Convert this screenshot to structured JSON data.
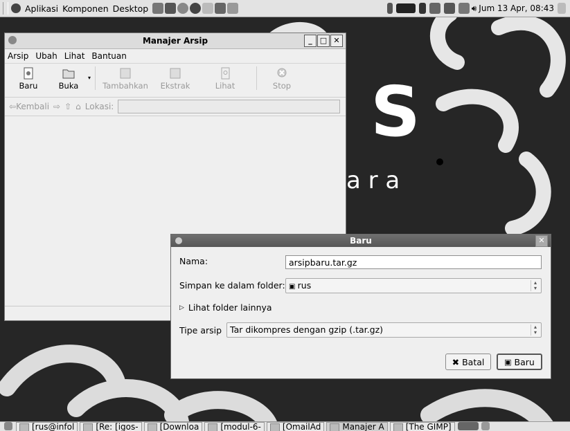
{
  "top_panel": {
    "menus": [
      "Aplikasi",
      "Komponen",
      "Desktop"
    ],
    "clock": "Jum 13 Apr, 08:43"
  },
  "desktop_text": {
    "big_s": "S",
    "ara": "a r a"
  },
  "main_window": {
    "title": "Manajer Arsip",
    "menu": [
      "Arsip",
      "Ubah",
      "Lihat",
      "Bantuan"
    ],
    "toolbar": [
      {
        "label": "Baru",
        "enabled": true
      },
      {
        "label": "Buka",
        "enabled": true
      },
      {
        "label": "Tambahkan",
        "enabled": false
      },
      {
        "label": "Ekstrak",
        "enabled": false
      },
      {
        "label": "Lihat",
        "enabled": false
      },
      {
        "label": "Stop",
        "enabled": false
      }
    ],
    "location": {
      "back": "Kembali",
      "label": "Lokasi:"
    }
  },
  "dialog": {
    "title": "Baru",
    "name_label": "Nama:",
    "name_value": "arsipbaru.tar.gz",
    "folder_label": "Simpan ke dalam folder:",
    "folder_value": "rus",
    "expander": "Lihat folder lainnya",
    "type_label": "Tipe arsip",
    "type_value": "Tar dikompres dengan gzip (.tar.gz)",
    "cancel": "Batal",
    "ok": "Baru"
  },
  "taskbar": {
    "tasks": [
      "[rus@infol",
      "[Re: [igos-",
      "[Downloa",
      "[modul-6-",
      "[OmailAd",
      "Manajer A",
      "[The GIMP]"
    ]
  },
  "colors": {
    "desktop_bg": "#262626",
    "panel": "#e3e3e3",
    "dialog_title": "#626262"
  }
}
